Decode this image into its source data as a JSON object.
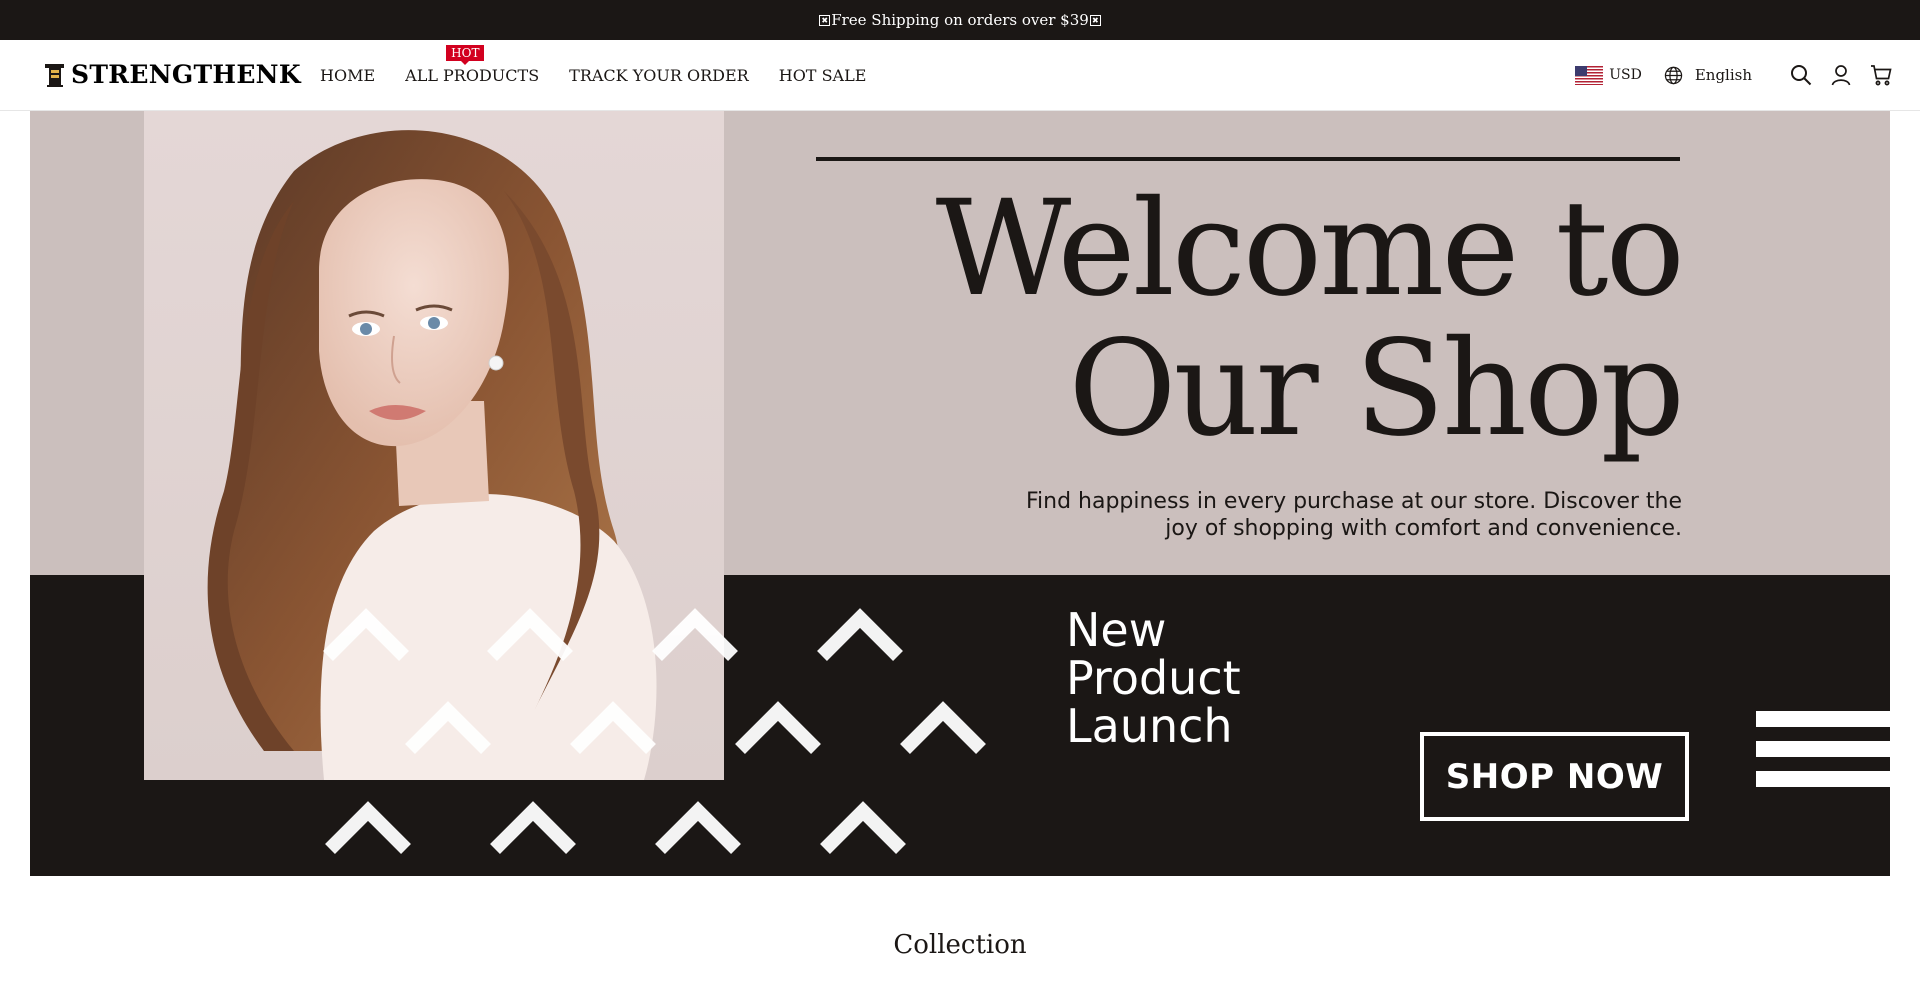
{
  "announcement": {
    "text": "Free Shipping on orders over $39",
    "star_glyph": "✖"
  },
  "header": {
    "logo_text": "STRENGTHENK",
    "nav": [
      {
        "label": "HOME"
      },
      {
        "label": "ALL PRODUCTS",
        "badge": "HOT"
      },
      {
        "label": "TRACK YOUR ORDER"
      },
      {
        "label": "HOT SALE"
      }
    ],
    "currency": "USD",
    "language": "English",
    "icons": [
      "us-flag-icon",
      "globe-icon",
      "search-icon",
      "account-icon",
      "cart-icon"
    ]
  },
  "hero": {
    "title_line1": "Welcome to",
    "title_line2": "Our Shop",
    "subtitle": "Find happiness in every purchase at our store. Discover the joy of shopping with comfort and convenience.",
    "launch_line1": "New",
    "launch_line2": "Product",
    "launch_line3": "Launch",
    "cta": "SHOP NOW"
  },
  "section": {
    "title": "Collection"
  },
  "colors": {
    "dark": "#1b1715",
    "hero_bg": "#cbbfbd",
    "hot_badge": "#d2001f",
    "white": "#ffffff"
  }
}
